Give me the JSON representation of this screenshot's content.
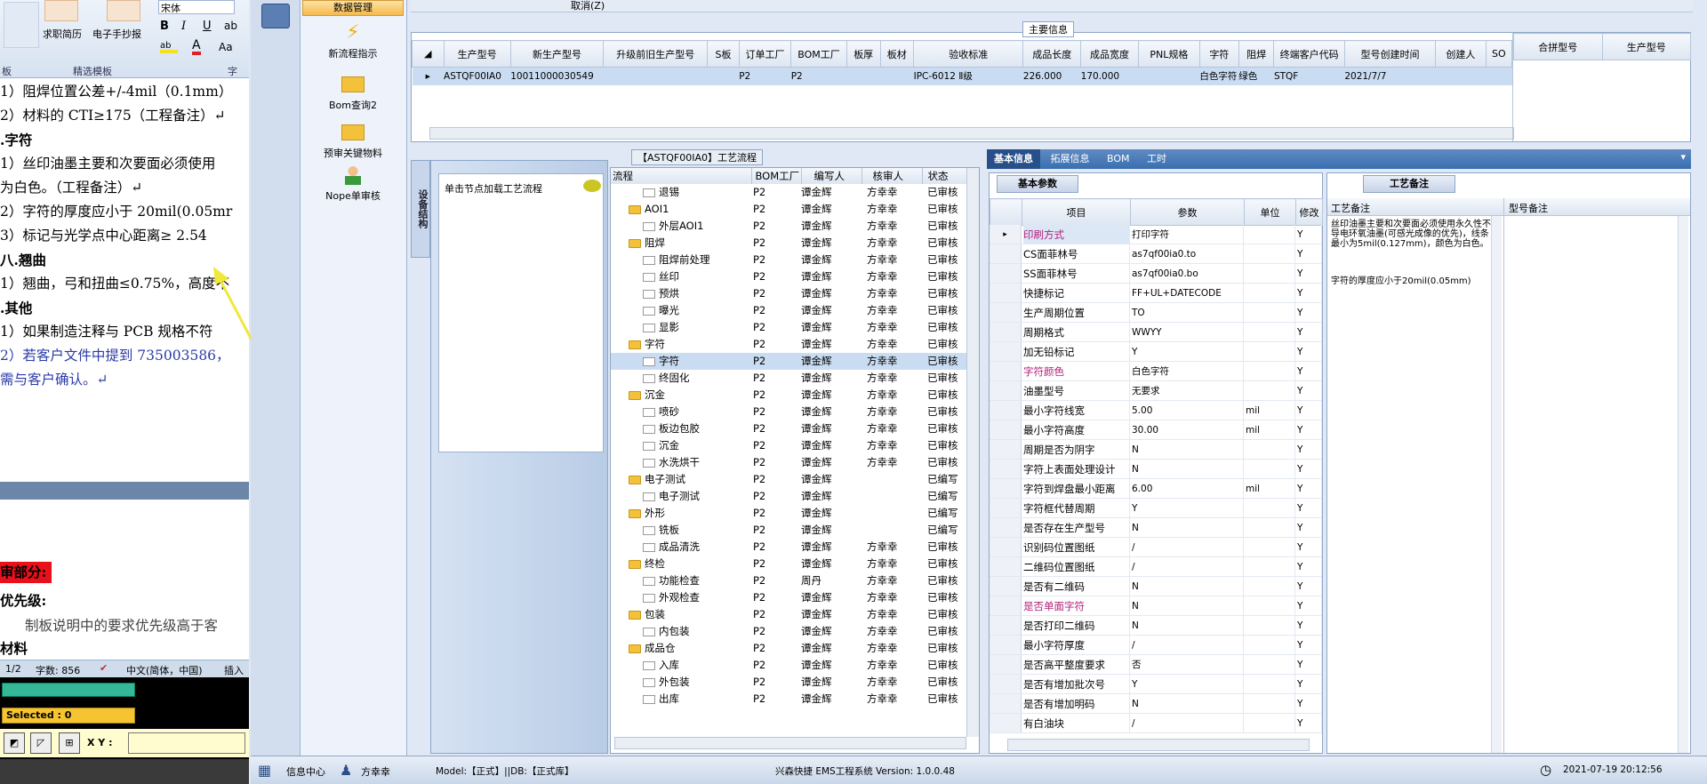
{
  "word": {
    "font_name": "宋体",
    "ribbon_buttons": [
      "求职简历",
      "电子手抄报"
    ],
    "ribbon_group": "精选模板",
    "ribbon_left": "板",
    "ribbon_right": "字",
    "lines": [
      "1）阻焊位置公差+/-4mil（0.1mm）",
      "2）材料的 CTI≥175（工程备注）↵",
      ".字符",
      "1）丝印油墨主要和次要面必须使用",
      "为白色。（工程备注）↵",
      "2）字符的厚度应小于 20mil(0.05mr",
      "3）标记与光学点中心距离≥  2.54",
      "八.翘曲",
      "1）翘曲，弓和扭曲≤0.75%，高度不",
      ".其他",
      "1）如果制造注释与 PCB 规格不符",
      "2）若客户文件中提到 735003586，",
      "需与客户确认。↵"
    ],
    "lines2": [
      "审部分:",
      "优先级:",
      "制板说明中的要求优先级高于客",
      "材料"
    ],
    "status": {
      "page": "1/2",
      "words": "字数: 856",
      "lang": "中文(简体，中国)",
      "insert": "插入"
    },
    "selected": "Selected : 0",
    "xy": "X Y :"
  },
  "sidebar": {
    "header": "数据管理",
    "items": [
      "新流程指示",
      "Bom查询2",
      "预审关键物料",
      "Nope单审核"
    ]
  },
  "top_info": {
    "cancel": "取消(Z)",
    "title": "主要信息",
    "columns": [
      "生产型号",
      "新生产型号",
      "升级前旧生产型号",
      "S板",
      "订单工厂",
      "BOM工厂",
      "板厚",
      "板材",
      "验收标准",
      "成品长度",
      "成品宽度",
      "PNL规格",
      "字符",
      "阻焊",
      "终端客户代码",
      "型号创建时间",
      "创建人",
      "SO"
    ],
    "row": [
      "ASTQF00IA0",
      "10011000030549",
      "",
      "",
      "P2",
      "P2",
      "",
      "",
      "IPC-6012 Ⅱ级",
      "226.000",
      "170.000",
      "",
      "白色字符",
      "绿色",
      "STQF",
      "2021/7/7",
      "",
      ""
    ],
    "right_columns": [
      "合拼型号",
      "生产型号"
    ]
  },
  "process": {
    "title": "【ASTQF00IA0】工艺流程",
    "side_tab": "设备结构",
    "load_hint": "单击节点加载工艺流程",
    "columns": [
      "流程",
      "BOM工厂",
      "编写人",
      "核审人",
      "状态"
    ],
    "rows": [
      {
        "indent": 2,
        "type": "leaf",
        "name": "退锡",
        "f": "P2",
        "w": "谭金辉",
        "r": "方幸幸",
        "s": "已审核"
      },
      {
        "indent": 1,
        "type": "folder",
        "name": "AOI1",
        "f": "P2",
        "w": "谭金辉",
        "r": "方幸幸",
        "s": "已审核"
      },
      {
        "indent": 2,
        "type": "leaf",
        "name": "外层AOI1",
        "f": "P2",
        "w": "谭金辉",
        "r": "方幸幸",
        "s": "已审核"
      },
      {
        "indent": 1,
        "type": "folder",
        "name": "阻焊",
        "f": "P2",
        "w": "谭金辉",
        "r": "方幸幸",
        "s": "已审核"
      },
      {
        "indent": 2,
        "type": "leaf",
        "name": "阻焊前处理",
        "f": "P2",
        "w": "谭金辉",
        "r": "方幸幸",
        "s": "已审核"
      },
      {
        "indent": 2,
        "type": "leaf",
        "name": "丝印",
        "f": "P2",
        "w": "谭金辉",
        "r": "方幸幸",
        "s": "已审核"
      },
      {
        "indent": 2,
        "type": "leaf",
        "name": "预烘",
        "f": "P2",
        "w": "谭金辉",
        "r": "方幸幸",
        "s": "已审核"
      },
      {
        "indent": 2,
        "type": "leaf",
        "name": "曝光",
        "f": "P2",
        "w": "谭金辉",
        "r": "方幸幸",
        "s": "已审核"
      },
      {
        "indent": 2,
        "type": "leaf",
        "name": "显影",
        "f": "P2",
        "w": "谭金辉",
        "r": "方幸幸",
        "s": "已审核"
      },
      {
        "indent": 1,
        "type": "folder",
        "name": "字符",
        "f": "P2",
        "w": "谭金辉",
        "r": "方幸幸",
        "s": "已审核"
      },
      {
        "indent": 2,
        "type": "leaf",
        "name": "字符",
        "f": "P2",
        "w": "谭金辉",
        "r": "方幸幸",
        "s": "已审核",
        "sel": true
      },
      {
        "indent": 2,
        "type": "leaf",
        "name": "终固化",
        "f": "P2",
        "w": "谭金辉",
        "r": "方幸幸",
        "s": "已审核"
      },
      {
        "indent": 1,
        "type": "folder",
        "name": "沉金",
        "f": "P2",
        "w": "谭金辉",
        "r": "方幸幸",
        "s": "已审核"
      },
      {
        "indent": 2,
        "type": "leaf",
        "name": "喷砂",
        "f": "P2",
        "w": "谭金辉",
        "r": "方幸幸",
        "s": "已审核"
      },
      {
        "indent": 2,
        "type": "leaf",
        "name": "板边包胶",
        "f": "P2",
        "w": "谭金辉",
        "r": "方幸幸",
        "s": "已审核"
      },
      {
        "indent": 2,
        "type": "leaf",
        "name": "沉金",
        "f": "P2",
        "w": "谭金辉",
        "r": "方幸幸",
        "s": "已审核"
      },
      {
        "indent": 2,
        "type": "leaf",
        "name": "水洗烘干",
        "f": "P2",
        "w": "谭金辉",
        "r": "方幸幸",
        "s": "已审核"
      },
      {
        "indent": 1,
        "type": "folder",
        "name": "电子测试",
        "f": "P2",
        "w": "谭金辉",
        "r": "",
        "s": "已编写"
      },
      {
        "indent": 2,
        "type": "leaf",
        "name": "电子测试",
        "f": "P2",
        "w": "谭金辉",
        "r": "",
        "s": "已编写"
      },
      {
        "indent": 1,
        "type": "folder",
        "name": "外形",
        "f": "P2",
        "w": "谭金辉",
        "r": "",
        "s": "已编写"
      },
      {
        "indent": 2,
        "type": "leaf",
        "name": "铣板",
        "f": "P2",
        "w": "谭金辉",
        "r": "",
        "s": "已编写"
      },
      {
        "indent": 2,
        "type": "leaf",
        "name": "成品清洗",
        "f": "P2",
        "w": "谭金辉",
        "r": "方幸幸",
        "s": "已审核"
      },
      {
        "indent": 1,
        "type": "folder",
        "name": "终检",
        "f": "P2",
        "w": "谭金辉",
        "r": "方幸幸",
        "s": "已审核"
      },
      {
        "indent": 2,
        "type": "leaf",
        "name": "功能检查",
        "f": "P2",
        "w": "周丹",
        "r": "方幸幸",
        "s": "已审核"
      },
      {
        "indent": 2,
        "type": "leaf",
        "name": "外观检查",
        "f": "P2",
        "w": "谭金辉",
        "r": "方幸幸",
        "s": "已审核"
      },
      {
        "indent": 1,
        "type": "folder",
        "name": "包装",
        "f": "P2",
        "w": "谭金辉",
        "r": "方幸幸",
        "s": "已审核"
      },
      {
        "indent": 2,
        "type": "leaf",
        "name": "内包装",
        "f": "P2",
        "w": "谭金辉",
        "r": "方幸幸",
        "s": "已审核"
      },
      {
        "indent": 1,
        "type": "folder",
        "name": "成品仓",
        "f": "P2",
        "w": "谭金辉",
        "r": "方幸幸",
        "s": "已审核"
      },
      {
        "indent": 2,
        "type": "leaf",
        "name": "入库",
        "f": "P2",
        "w": "谭金辉",
        "r": "方幸幸",
        "s": "已审核"
      },
      {
        "indent": 2,
        "type": "leaf",
        "name": "外包装",
        "f": "P2",
        "w": "谭金辉",
        "r": "方幸幸",
        "s": "已审核"
      },
      {
        "indent": 2,
        "type": "leaf",
        "name": "出库",
        "f": "P2",
        "w": "谭金辉",
        "r": "方幸幸",
        "s": "已审核"
      }
    ]
  },
  "params": {
    "tabs": [
      "基本信息",
      "拓展信息",
      "BOM",
      "工时"
    ],
    "subtab": "基本参数",
    "columns": [
      "项目",
      "参数",
      "单位",
      "修改"
    ],
    "rows": [
      {
        "k": "印刷方式",
        "v": "打印字符",
        "u": "",
        "m": "Y",
        "hl": true
      },
      {
        "k": "CS面菲林号",
        "v": "as7qf00ia0.to",
        "u": "",
        "m": "Y"
      },
      {
        "k": "SS面菲林号",
        "v": "as7qf00ia0.bo",
        "u": "",
        "m": "Y"
      },
      {
        "k": "快捷标记",
        "v": "FF+UL+DATECODE",
        "u": "",
        "m": "Y"
      },
      {
        "k": "生产周期位置",
        "v": "TO",
        "u": "",
        "m": "Y"
      },
      {
        "k": "周期格式",
        "v": "WWYY",
        "u": "",
        "m": "Y"
      },
      {
        "k": "加无铅标记",
        "v": "Y",
        "u": "",
        "m": "Y"
      },
      {
        "k": "字符颜色",
        "v": "白色字符",
        "u": "",
        "m": "Y",
        "hl": true
      },
      {
        "k": "油墨型号",
        "v": "无要求",
        "u": "",
        "m": "Y"
      },
      {
        "k": "最小字符线宽",
        "v": "5.00",
        "u": "mil",
        "m": "Y"
      },
      {
        "k": "最小字符高度",
        "v": "30.00",
        "u": "mil",
        "m": "Y"
      },
      {
        "k": "周期是否为阴字",
        "v": "N",
        "u": "",
        "m": "Y"
      },
      {
        "k": "字符上表面处理设计",
        "v": "N",
        "u": "",
        "m": "Y"
      },
      {
        "k": "字符到焊盘最小距离",
        "v": "6.00",
        "u": "mil",
        "m": "Y"
      },
      {
        "k": "字符框代替周期",
        "v": "Y",
        "u": "",
        "m": "Y"
      },
      {
        "k": "是否存在生产型号",
        "v": "N",
        "u": "",
        "m": "Y"
      },
      {
        "k": "识别码位置图纸",
        "v": "/",
        "u": "",
        "m": "Y"
      },
      {
        "k": "二维码位置图纸",
        "v": "/",
        "u": "",
        "m": "Y"
      },
      {
        "k": "是否有二维码",
        "v": "N",
        "u": "",
        "m": "Y"
      },
      {
        "k": "是否单面字符",
        "v": "N",
        "u": "",
        "m": "Y",
        "hl": true
      },
      {
        "k": "是否打印二维码",
        "v": "N",
        "u": "",
        "m": "Y"
      },
      {
        "k": "最小字符厚度",
        "v": "/",
        "u": "",
        "m": "Y"
      },
      {
        "k": "是否高平整度要求",
        "v": "否",
        "u": "",
        "m": "Y"
      },
      {
        "k": "是否有增加批次号",
        "v": "Y",
        "u": "",
        "m": "Y"
      },
      {
        "k": "是否有增加明码",
        "v": "N",
        "u": "",
        "m": "Y"
      },
      {
        "k": "有白油块",
        "v": "/",
        "u": "",
        "m": "Y"
      }
    ]
  },
  "notes": {
    "tab": "工艺备注",
    "col1": "工艺备注",
    "col2": "型号备注",
    "text1": "丝印油墨主要和次要面必须使用永久性不导电环氧油墨(可感光成像的优先)，线条最小为5mil(0.127mm)，颜色为白色。",
    "text2": "字符的厚度应小于20mil(0.05mm)"
  },
  "statusbar": {
    "info": "信息中心",
    "user": "方幸幸",
    "model": "Model:【正式】||DB:【正式库】",
    "app": "兴森快捷 EMS工程系统 Version: 1.0.0.48",
    "datetime": "2021-07-19 20:12:56"
  },
  "colors": {
    "accent": "#3a6fb0",
    "highlight_text": "#b0207a",
    "selected_row": "#c9dcf2"
  }
}
